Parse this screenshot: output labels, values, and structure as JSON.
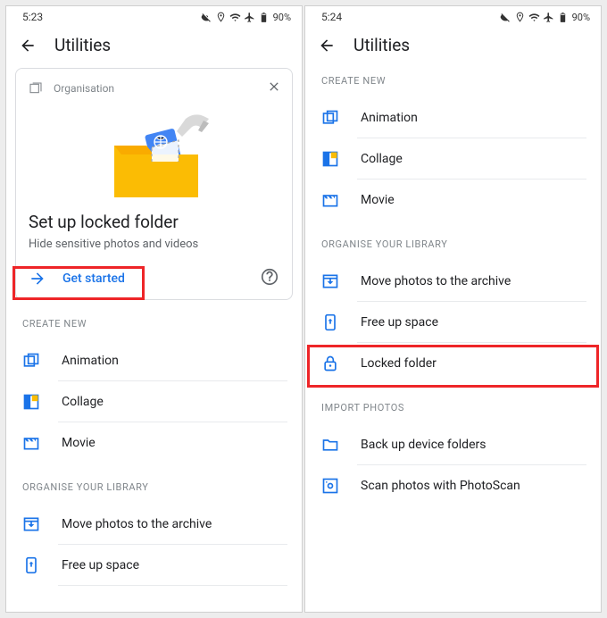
{
  "left": {
    "status_time": "5:23",
    "battery": "90%",
    "app_title": "Utilities",
    "card": {
      "tag": "Organisation",
      "title": "Set up locked folder",
      "subtitle": "Hide sensitive photos and videos",
      "cta": "Get started"
    },
    "section_create": "CREATE NEW",
    "items_create": [
      {
        "label": "Animation"
      },
      {
        "label": "Collage"
      },
      {
        "label": "Movie"
      }
    ],
    "section_org": "ORGANISE YOUR LIBRARY",
    "items_org": [
      {
        "label": "Move photos to the archive"
      },
      {
        "label": "Free up space"
      }
    ]
  },
  "right": {
    "status_time": "5:24",
    "battery": "90%",
    "app_title": "Utilities",
    "section_create": "CREATE NEW",
    "items_create": [
      {
        "label": "Animation"
      },
      {
        "label": "Collage"
      },
      {
        "label": "Movie"
      }
    ],
    "section_org": "ORGANISE YOUR LIBRARY",
    "items_org": [
      {
        "label": "Move photos to the archive"
      },
      {
        "label": "Free up space"
      },
      {
        "label": "Locked folder"
      }
    ],
    "section_import": "IMPORT PHOTOS",
    "items_import": [
      {
        "label": "Back up device folders"
      },
      {
        "label": "Scan photos with PhotoScan"
      }
    ]
  }
}
